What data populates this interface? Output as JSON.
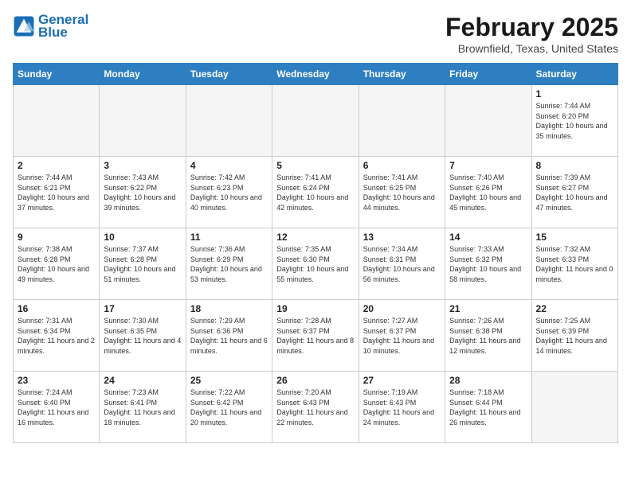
{
  "header": {
    "logo_line1": "General",
    "logo_line2": "Blue",
    "month": "February 2025",
    "location": "Brownfield, Texas, United States"
  },
  "weekdays": [
    "Sunday",
    "Monday",
    "Tuesday",
    "Wednesday",
    "Thursday",
    "Friday",
    "Saturday"
  ],
  "weeks": [
    [
      {
        "day": "",
        "info": ""
      },
      {
        "day": "",
        "info": ""
      },
      {
        "day": "",
        "info": ""
      },
      {
        "day": "",
        "info": ""
      },
      {
        "day": "",
        "info": ""
      },
      {
        "day": "",
        "info": ""
      },
      {
        "day": "1",
        "info": "Sunrise: 7:44 AM\nSunset: 6:20 PM\nDaylight: 10 hours and 35 minutes."
      }
    ],
    [
      {
        "day": "2",
        "info": "Sunrise: 7:44 AM\nSunset: 6:21 PM\nDaylight: 10 hours and 37 minutes."
      },
      {
        "day": "3",
        "info": "Sunrise: 7:43 AM\nSunset: 6:22 PM\nDaylight: 10 hours and 39 minutes."
      },
      {
        "day": "4",
        "info": "Sunrise: 7:42 AM\nSunset: 6:23 PM\nDaylight: 10 hours and 40 minutes."
      },
      {
        "day": "5",
        "info": "Sunrise: 7:41 AM\nSunset: 6:24 PM\nDaylight: 10 hours and 42 minutes."
      },
      {
        "day": "6",
        "info": "Sunrise: 7:41 AM\nSunset: 6:25 PM\nDaylight: 10 hours and 44 minutes."
      },
      {
        "day": "7",
        "info": "Sunrise: 7:40 AM\nSunset: 6:26 PM\nDaylight: 10 hours and 45 minutes."
      },
      {
        "day": "8",
        "info": "Sunrise: 7:39 AM\nSunset: 6:27 PM\nDaylight: 10 hours and 47 minutes."
      }
    ],
    [
      {
        "day": "9",
        "info": "Sunrise: 7:38 AM\nSunset: 6:28 PM\nDaylight: 10 hours and 49 minutes."
      },
      {
        "day": "10",
        "info": "Sunrise: 7:37 AM\nSunset: 6:28 PM\nDaylight: 10 hours and 51 minutes."
      },
      {
        "day": "11",
        "info": "Sunrise: 7:36 AM\nSunset: 6:29 PM\nDaylight: 10 hours and 53 minutes."
      },
      {
        "day": "12",
        "info": "Sunrise: 7:35 AM\nSunset: 6:30 PM\nDaylight: 10 hours and 55 minutes."
      },
      {
        "day": "13",
        "info": "Sunrise: 7:34 AM\nSunset: 6:31 PM\nDaylight: 10 hours and 56 minutes."
      },
      {
        "day": "14",
        "info": "Sunrise: 7:33 AM\nSunset: 6:32 PM\nDaylight: 10 hours and 58 minutes."
      },
      {
        "day": "15",
        "info": "Sunrise: 7:32 AM\nSunset: 6:33 PM\nDaylight: 11 hours and 0 minutes."
      }
    ],
    [
      {
        "day": "16",
        "info": "Sunrise: 7:31 AM\nSunset: 6:34 PM\nDaylight: 11 hours and 2 minutes."
      },
      {
        "day": "17",
        "info": "Sunrise: 7:30 AM\nSunset: 6:35 PM\nDaylight: 11 hours and 4 minutes."
      },
      {
        "day": "18",
        "info": "Sunrise: 7:29 AM\nSunset: 6:36 PM\nDaylight: 11 hours and 6 minutes."
      },
      {
        "day": "19",
        "info": "Sunrise: 7:28 AM\nSunset: 6:37 PM\nDaylight: 11 hours and 8 minutes."
      },
      {
        "day": "20",
        "info": "Sunrise: 7:27 AM\nSunset: 6:37 PM\nDaylight: 11 hours and 10 minutes."
      },
      {
        "day": "21",
        "info": "Sunrise: 7:26 AM\nSunset: 6:38 PM\nDaylight: 11 hours and 12 minutes."
      },
      {
        "day": "22",
        "info": "Sunrise: 7:25 AM\nSunset: 6:39 PM\nDaylight: 11 hours and 14 minutes."
      }
    ],
    [
      {
        "day": "23",
        "info": "Sunrise: 7:24 AM\nSunset: 6:40 PM\nDaylight: 11 hours and 16 minutes."
      },
      {
        "day": "24",
        "info": "Sunrise: 7:23 AM\nSunset: 6:41 PM\nDaylight: 11 hours and 18 minutes."
      },
      {
        "day": "25",
        "info": "Sunrise: 7:22 AM\nSunset: 6:42 PM\nDaylight: 11 hours and 20 minutes."
      },
      {
        "day": "26",
        "info": "Sunrise: 7:20 AM\nSunset: 6:43 PM\nDaylight: 11 hours and 22 minutes."
      },
      {
        "day": "27",
        "info": "Sunrise: 7:19 AM\nSunset: 6:43 PM\nDaylight: 11 hours and 24 minutes."
      },
      {
        "day": "28",
        "info": "Sunrise: 7:18 AM\nSunset: 6:44 PM\nDaylight: 11 hours and 26 minutes."
      },
      {
        "day": "",
        "info": ""
      }
    ]
  ]
}
